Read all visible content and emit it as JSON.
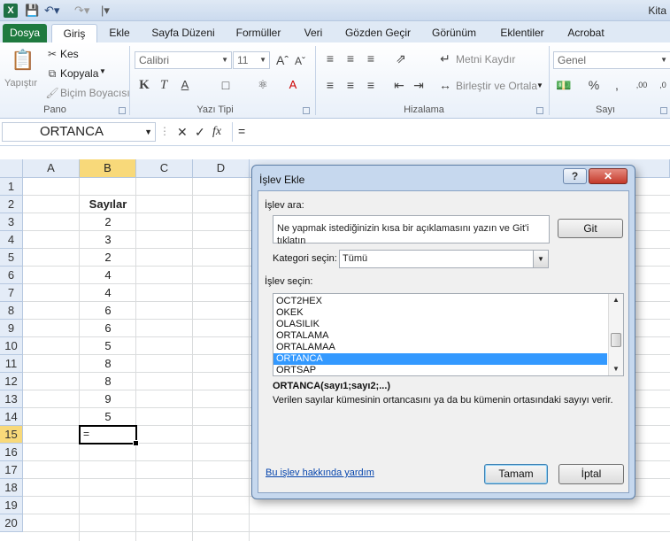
{
  "titlebar": {
    "app_icon": "excel-icon",
    "qat": [
      "save-icon",
      "undo-icon",
      "redo-icon"
    ],
    "title": "Kita"
  },
  "ribbon": {
    "file_tab": "Dosya",
    "tabs": [
      "Giriş",
      "Ekle",
      "Sayfa Düzeni",
      "Formüller",
      "Veri",
      "Gözden Geçir",
      "Görünüm",
      "Eklentiler",
      "Acrobat"
    ],
    "active_tab": "Giriş",
    "clipboard": {
      "label": "Pano",
      "paste": "Yapıştır",
      "cut": "Kes",
      "copy": "Kopyala",
      "format_painter": "Biçim Boyacısı"
    },
    "font": {
      "label": "Yazı Tipi",
      "font_name": "Calibri",
      "font_size": "11"
    },
    "alignment": {
      "label": "Hizalama",
      "wrap_text": "Metni Kaydır",
      "merge_center": "Birleştir ve Ortala"
    },
    "number": {
      "label": "Sayı",
      "format": "Genel"
    }
  },
  "formula_bar": {
    "name_box": "ORTANCA",
    "formula": "="
  },
  "sheet": {
    "columns": [
      "A",
      "B",
      "C",
      "D"
    ],
    "selected_column": "B",
    "rows": [
      "1",
      "2",
      "3",
      "4",
      "5",
      "6",
      "7",
      "8",
      "9",
      "10",
      "11",
      "12",
      "13",
      "14",
      "15",
      "16",
      "17",
      "18",
      "19",
      "20"
    ],
    "selected_row": "15",
    "header_cell": "Sayılar",
    "values": [
      "2",
      "3",
      "2",
      "4",
      "4",
      "6",
      "6",
      "5",
      "8",
      "8",
      "9",
      "5"
    ],
    "active_cell_content": "="
  },
  "dialog": {
    "title": "İşlev Ekle",
    "help_button": "?",
    "close_button": "✕",
    "search_label": "İşlev ara:",
    "search_text": "Ne yapmak istediğinizin kısa bir açıklamasını yazın ve Git'i tıklatın",
    "go_button": "Git",
    "category_label": "Kategori seçin:",
    "category_value": "Tümü",
    "select_label": "İşlev seçin:",
    "functions": [
      "OCT2HEX",
      "OKEK",
      "OLASILIK",
      "ORTALAMA",
      "ORTALAMAA",
      "ORTANCA",
      "ORTSAP"
    ],
    "selected_function": "ORTANCA",
    "signature": "ORTANCA(sayı1;sayı2;...)",
    "description": "Verilen sayılar kümesinin ortancasını ya da bu kümenin ortasındaki sayıyı verir.",
    "help_link": "Bu işlev hakkında yardım",
    "ok_button": "Tamam",
    "cancel_button": "İptal"
  }
}
